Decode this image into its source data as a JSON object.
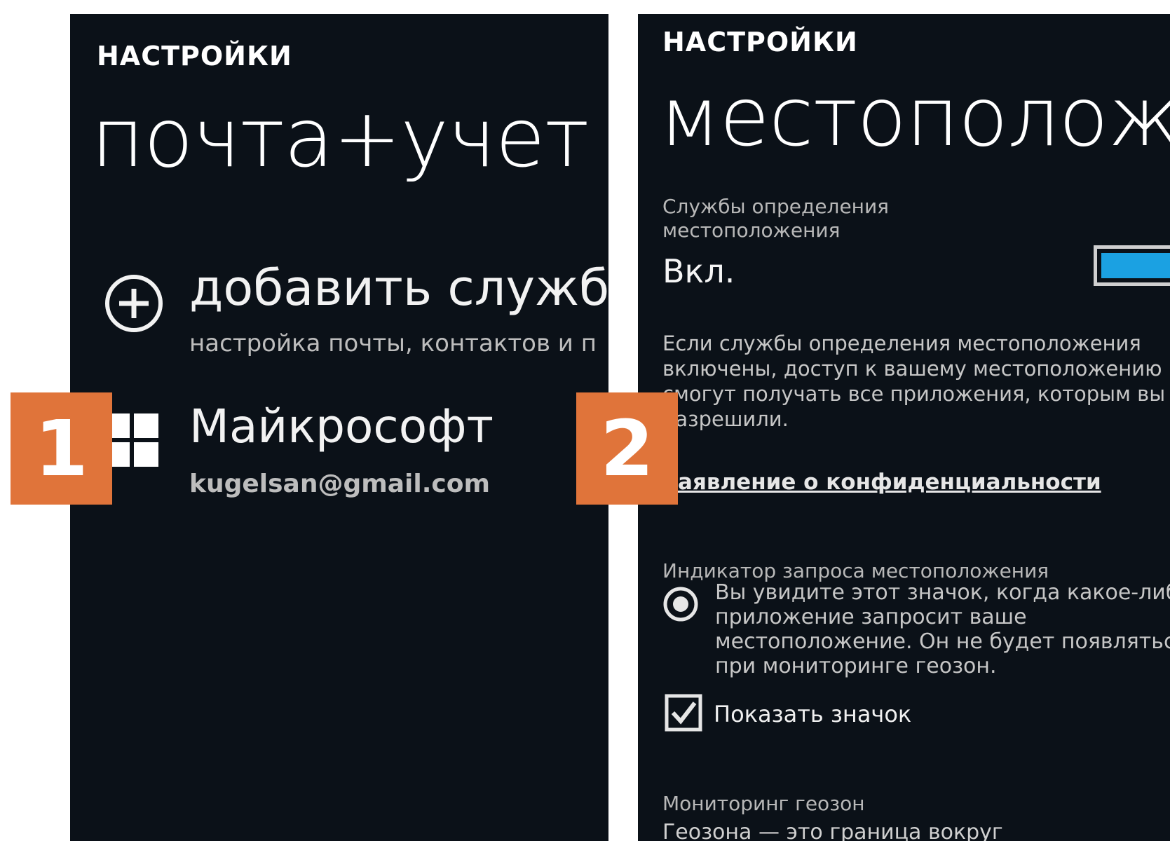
{
  "screen1": {
    "kicker": "НАСТРОЙКИ",
    "title": "почта+учет",
    "add": {
      "title": "добавить службу",
      "subtitle": "настройка почты, контактов и п"
    },
    "account": {
      "name": "Майкрософт",
      "email": "kugelsan@gmail.com"
    }
  },
  "screen2": {
    "kicker": "НАСТРОЙКИ",
    "title": "местоположен",
    "services_label_1": "Службы определения",
    "services_label_2": "местоположения",
    "toggle_state": "Вкл.",
    "toggle_on": true,
    "accent": "#1ba1e2",
    "paragraph": [
      "Если службы определения местоположения",
      "включены, доступ к вашему местоположению",
      "смогут получать все приложения, которым вы эт",
      "разрешили."
    ],
    "privacy_link": "Заявление о конфиденциальности",
    "indicator_label": "Индикатор запроса местоположения",
    "indicator_text": [
      "Вы увидите этот значок, когда какое-либо",
      "приложение запросит ваше",
      "местоположение. Он не будет появляться",
      "при мониторинге геозон."
    ],
    "show_icon_label": "Показать значок",
    "show_icon_checked": true,
    "geofence_label": "Мониторинг геозон",
    "geofence_text": "Геозона — это граница вокруг"
  },
  "badges": {
    "one": "1",
    "two": "2",
    "color": "#e0743a"
  }
}
